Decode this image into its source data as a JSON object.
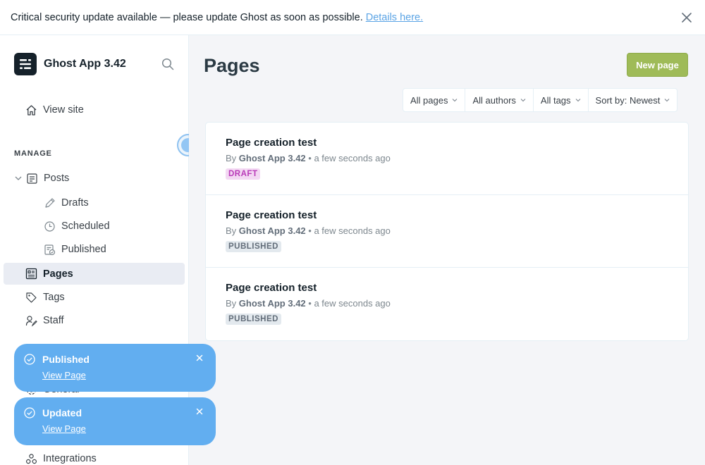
{
  "alert": {
    "message": "Critical security update available — please update Ghost as soon as possible.",
    "link": "Details here."
  },
  "sidebar": {
    "brand": "Ghost App 3.42",
    "view_site": "View site",
    "section_manage": "MANAGE",
    "items": {
      "posts": "Posts",
      "drafts": "Drafts",
      "scheduled": "Scheduled",
      "published": "Published",
      "pages": "Pages",
      "tags": "Tags",
      "staff": "Staff",
      "general": "General",
      "integrations": "Integrations"
    }
  },
  "main": {
    "title": "Pages",
    "new_button": "New page",
    "filters": [
      "All pages",
      "All authors",
      "All tags",
      "Sort by: Newest"
    ],
    "rows": [
      {
        "title": "Page creation test",
        "by": "By",
        "author": "Ghost App 3.42",
        "time": "• a few seconds ago",
        "status": "DRAFT"
      },
      {
        "title": "Page creation test",
        "by": "By",
        "author": "Ghost App 3.42",
        "time": "• a few seconds ago",
        "status": "PUBLISHED"
      },
      {
        "title": "Page creation test",
        "by": "By",
        "author": "Ghost App 3.42",
        "time": "• a few seconds ago",
        "status": "PUBLISHED"
      }
    ]
  },
  "toasts": [
    {
      "title": "Published",
      "link": "View Page"
    },
    {
      "title": "Updated",
      "link": "View Page"
    }
  ],
  "colors": {
    "accent": "#62aef0",
    "primary_button": "#9fbb58",
    "draft": "#b93ab8"
  }
}
